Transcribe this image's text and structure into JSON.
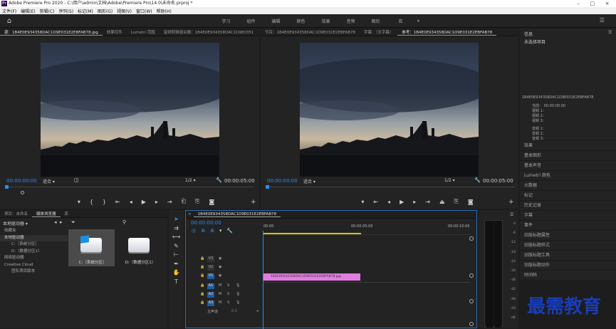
{
  "app": {
    "title": "Adobe Premiere Pro 2020 - C:\\用户\\admin\\文档\\Adobe\\Premiere Pro\\14.0\\未命名.prproj *",
    "logo": "Pr"
  },
  "menu": [
    "文件(F)",
    "编辑(E)",
    "剪辑(C)",
    "序列(S)",
    "标记(M)",
    "图形(G)",
    "视图(V)",
    "窗口(W)",
    "帮助(H)"
  ],
  "workspaces": [
    "学习",
    "组件",
    "编辑",
    "颜色",
    "效果",
    "音频",
    "图形",
    "库"
  ],
  "source": {
    "tabs": [
      "源：1B4E0E934358DAC1D9E031E2EBFAB78.jpg",
      "效果控件",
      "Lumetri 范围",
      "音频剪辑混合器：1B4E0E934358DAC1D9E0351"
    ],
    "timecode": "00:00:00:00",
    "fit": "适合",
    "ratio": "1/2",
    "duration": "00:00:05:00"
  },
  "program": {
    "tabs": [
      "节目：1B4E0E934358DAC1D9E031E2EBFAB78",
      "字幕：（无字幕）",
      "参考：1B4E0E934358DAC1D9E031E2EBFAB78"
    ],
    "timecode": "00:00:00:00",
    "fit": "适合",
    "ratio": "1/2",
    "duration": "00:00:05:00"
  },
  "info": {
    "header": "信息",
    "none": "未选择项目",
    "clip": "1B4E0E934358DAC1D9E031E2EBFAB78",
    "current_label": "当前：",
    "current": "00:00:00:00",
    "lines": [
      "视频 1：",
      "视频 2：",
      "视频 3：",
      "音频 1：",
      "音频 2：",
      "音频 3："
    ]
  },
  "panels": [
    "效果",
    "基本图形",
    "基本声音",
    "Lumetri 颜色",
    "元数据",
    "标记",
    "历史记录",
    "字幕",
    "事件",
    "旧版标题属性",
    "旧版标题样式",
    "旧版标题工具",
    "旧版标题动作",
    "时间码"
  ],
  "project": {
    "tabs": [
      "项目：未命名",
      "媒体浏览器",
      "库"
    ],
    "location": "本地驱动器",
    "tree": [
      "收藏夹",
      "本地驱动器",
      "C:（系统分区）",
      "D:（数据分区1）",
      "网络驱动器",
      "Creative Cloud",
      "团队项目版本"
    ],
    "drives": [
      {
        "name": "C:（系统分区）"
      },
      {
        "name": "D:（数据分区1）"
      }
    ]
  },
  "timeline": {
    "tab": "1B4E0E934358DAC1D9E031E2EBFAB78",
    "timecode": "00:00:00:00",
    "ruler": [
      "00:00",
      "00:00:05:00",
      "00:00:10:00"
    ],
    "tracks": [
      "V3",
      "V2",
      "V1",
      "A1",
      "A2",
      "A3"
    ],
    "master": "主声道",
    "master_value": "0.0",
    "clip": "1B4E0E934358DAC1D9E031E2EBFAB78.jpg"
  },
  "meter": {
    "scale": [
      "0",
      "-6",
      "-12",
      "-18",
      "-24",
      "-30",
      "-36",
      "-42",
      "-48",
      "-54",
      "dB"
    ]
  },
  "watermark": "最需教育",
  "colors": {
    "accent": "#2d8ceb",
    "clip": "#e37ce0",
    "panel": "#232323"
  }
}
